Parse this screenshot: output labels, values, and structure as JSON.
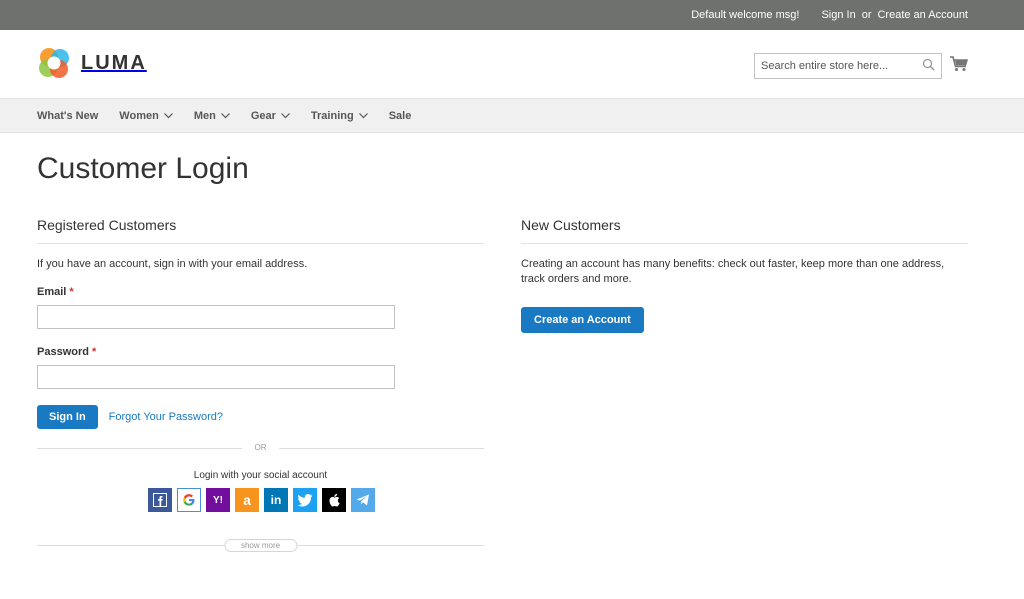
{
  "topbar": {
    "welcome": "Default welcome msg!",
    "sign_in": "Sign In",
    "or": "or",
    "create_account": "Create an Account"
  },
  "header": {
    "logo_text": "LUMA",
    "search_placeholder": "Search entire store here...",
    "search_icon": "search-icon",
    "cart_icon": "cart-icon"
  },
  "nav": {
    "items": [
      {
        "label": "What's New",
        "dropdown": false
      },
      {
        "label": "Women",
        "dropdown": true
      },
      {
        "label": "Men",
        "dropdown": true
      },
      {
        "label": "Gear",
        "dropdown": true
      },
      {
        "label": "Training",
        "dropdown": true
      },
      {
        "label": "Sale",
        "dropdown": false
      }
    ]
  },
  "page": {
    "title": "Customer Login"
  },
  "registered": {
    "title": "Registered Customers",
    "intro": "If you have an account, sign in with your email address.",
    "email_label": "Email",
    "email_value": "",
    "password_label": "Password",
    "password_value": "",
    "required_mark": "*",
    "sign_in_button": "Sign In",
    "forgot_link": "Forgot Your Password?",
    "or_text": "OR",
    "social_title": "Login with your social account",
    "social_providers": [
      "facebook",
      "google",
      "yahoo",
      "amazon",
      "linkedin",
      "twitter",
      "apple",
      "telegram"
    ],
    "show_more": "show more"
  },
  "new_customers": {
    "title": "New Customers",
    "intro": "Creating an account has many benefits: check out faster, keep more than one address, track orders and more.",
    "create_button": "Create an Account"
  },
  "colors": {
    "topbar": "#6e716e",
    "primary": "#1979c3",
    "nav_bg": "#f0f0f0",
    "required": "#e02b27"
  }
}
